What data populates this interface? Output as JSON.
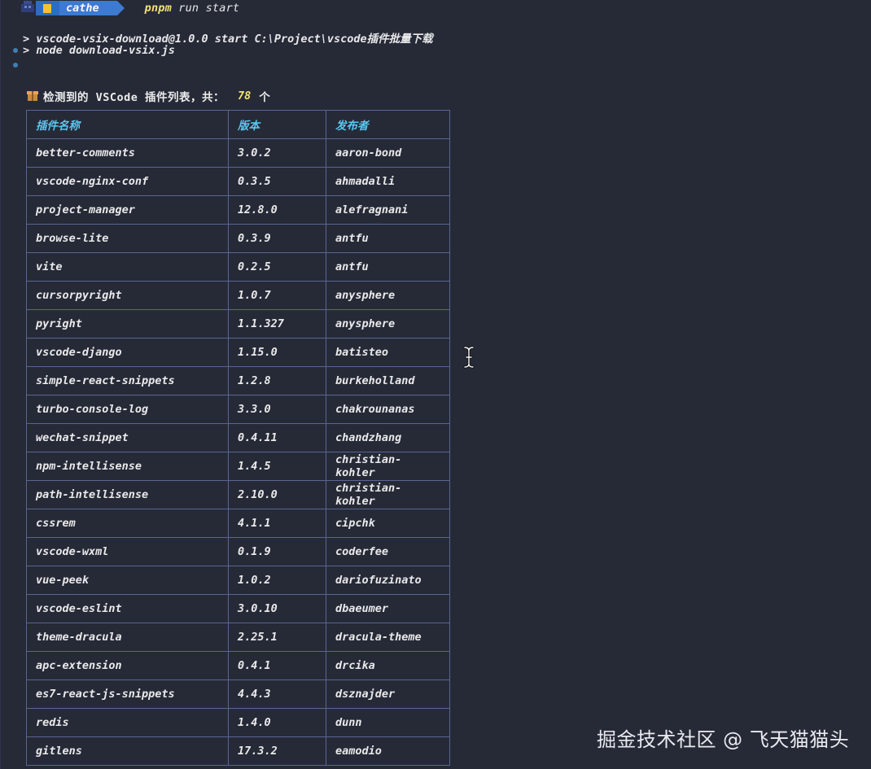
{
  "prompt": {
    "user": "cathe",
    "command": "pnpm",
    "command_args": " run start"
  },
  "output_lines": [
    "> vscode-vsix-download@1.0.0 start C:\\Project\\vscode插件批量下载",
    "> node download-vsix.js"
  ],
  "summary": {
    "label": "检测到的 VSCode 插件列表，共：",
    "count": "78",
    "unit": "个"
  },
  "table": {
    "headers": [
      "插件名称",
      "版本",
      "发布者"
    ],
    "rows": [
      [
        "better-comments",
        "3.0.2",
        "aaron-bond"
      ],
      [
        "vscode-nginx-conf",
        "0.3.5",
        "ahmadalli"
      ],
      [
        "project-manager",
        "12.8.0",
        "alefragnani"
      ],
      [
        "browse-lite",
        "0.3.9",
        "antfu"
      ],
      [
        "vite",
        "0.2.5",
        "antfu"
      ],
      [
        "cursorpyright",
        "1.0.7",
        "anysphere"
      ],
      [
        "pyright",
        "1.1.327",
        "anysphere"
      ],
      [
        "vscode-django",
        "1.15.0",
        "batisteo"
      ],
      [
        "simple-react-snippets",
        "1.2.8",
        "burkeholland"
      ],
      [
        "turbo-console-log",
        "3.3.0",
        "chakrounanas"
      ],
      [
        "wechat-snippet",
        "0.4.11",
        "chandzhang"
      ],
      [
        "npm-intellisense",
        "1.4.5",
        "christian-kohler"
      ],
      [
        "path-intellisense",
        "2.10.0",
        "christian-kohler"
      ],
      [
        "cssrem",
        "4.1.1",
        "cipchk"
      ],
      [
        "vscode-wxml",
        "0.1.9",
        "coderfee"
      ],
      [
        "vue-peek",
        "1.0.2",
        "dariofuzinato"
      ],
      [
        "vscode-eslint",
        "3.0.10",
        "dbaeumer"
      ],
      [
        "theme-dracula",
        "2.25.1",
        "dracula-theme"
      ],
      [
        "apc-extension",
        "0.4.1",
        "drcika"
      ],
      [
        "es7-react-js-snippets",
        "4.4.3",
        "dsznajder"
      ],
      [
        "redis",
        "1.4.0",
        "dunn"
      ],
      [
        "gitlens",
        "17.3.2",
        "eamodio"
      ]
    ]
  },
  "watermark": "掘金技术社区 @ 飞天猫猫头",
  "icons": {
    "prompt": "pixel-avatar-icon",
    "folder": "folder-icon",
    "package": "package-icon",
    "cursor": "text-cursor-icon"
  },
  "colors": {
    "background": "#262a37",
    "header_text": "#5ac8f0",
    "count": "#f2e17c",
    "table_border": "#5a6592",
    "badge_blue": "#3d7ad1"
  }
}
